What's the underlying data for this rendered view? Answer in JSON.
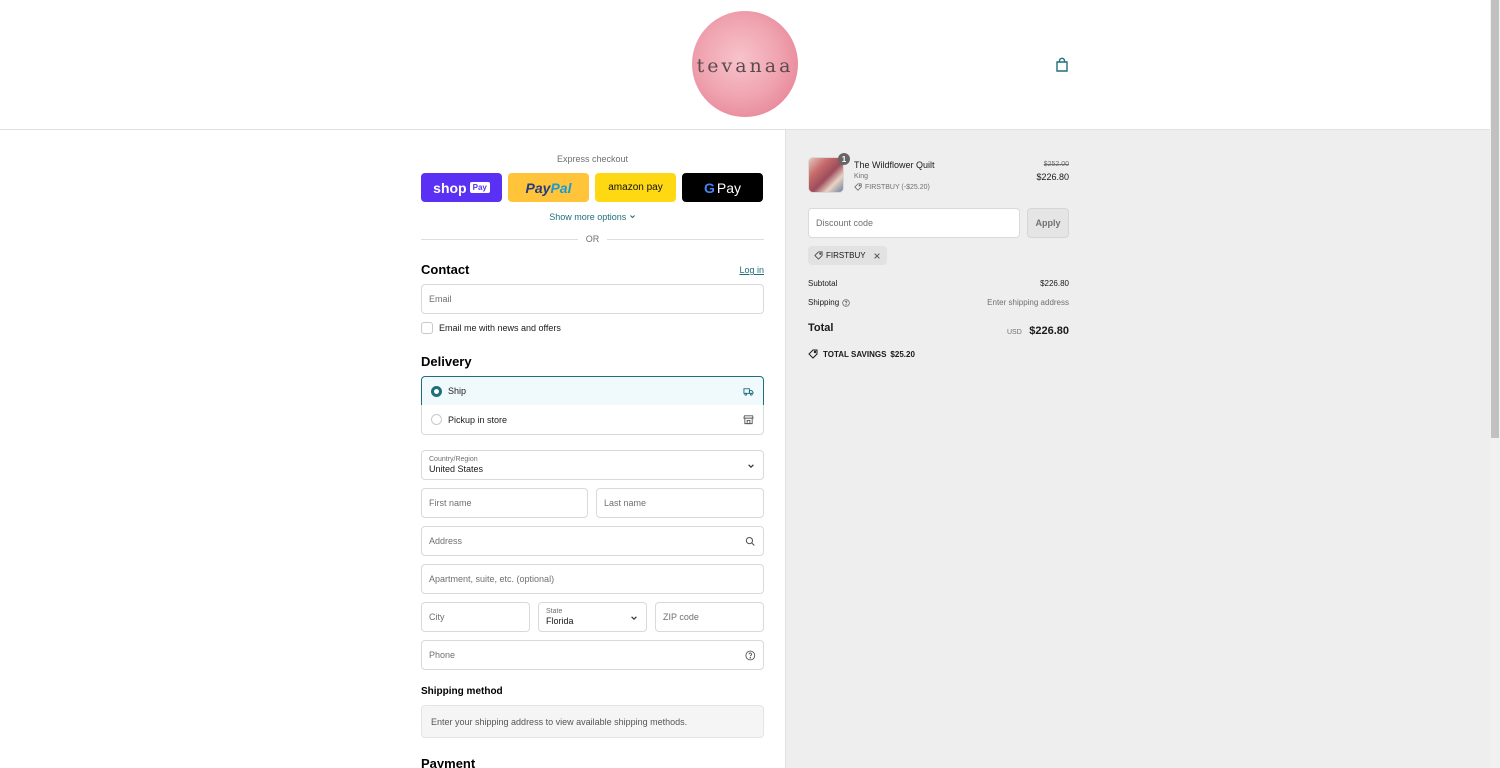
{
  "header": {
    "logo_text": "tevanaa"
  },
  "express": {
    "label": "Express checkout",
    "shop_pay": "shop",
    "shop_pay_badge": "Pay",
    "paypal_a": "Pay",
    "paypal_b": "Pal",
    "amazon_pay": "amazon pay",
    "gpay": "Pay",
    "gpay_g": "G",
    "show_more": "Show more options",
    "or": "OR"
  },
  "contact": {
    "title": "Contact",
    "login": "Log in",
    "email_placeholder": "Email",
    "newsletter": "Email me with news and offers"
  },
  "delivery": {
    "title": "Delivery",
    "options": [
      {
        "label": "Ship",
        "selected": true
      },
      {
        "label": "Pickup in store",
        "selected": false
      }
    ],
    "country_label": "Country/Region",
    "country_value": "United States",
    "first_name": "First name",
    "last_name": "Last name",
    "address": "Address",
    "apartment": "Apartment, suite, etc. (optional)",
    "city": "City",
    "state_label": "State",
    "state_value": "Florida",
    "zip": "ZIP code",
    "phone": "Phone"
  },
  "shipping_method": {
    "title": "Shipping method",
    "note": "Enter your shipping address to view available shipping methods."
  },
  "payment": {
    "title": "Payment"
  },
  "summary": {
    "product": {
      "name": "The Wildflower Quilt",
      "variant": "King",
      "discount": "FIRSTBUY (-$25.20)",
      "quantity": "1",
      "price_original": "$252.00",
      "price_final": "$226.80"
    },
    "discount_placeholder": "Discount code",
    "apply": "Apply",
    "applied_code": "FIRSTBUY",
    "subtotal_label": "Subtotal",
    "subtotal_value": "$226.80",
    "shipping_label": "Shipping",
    "shipping_value": "Enter shipping address",
    "total_label": "Total",
    "currency": "USD",
    "total_value": "$226.80",
    "savings_label": "TOTAL SAVINGS",
    "savings_value": "$25.20"
  },
  "colors": {
    "accent": "#1f6f7a",
    "shop_pay": "#5a31f4",
    "paypal": "#ffc439",
    "amazon_pay": "#ffd814",
    "gpay": "#000000",
    "summary_bg": "#eeeeee"
  }
}
